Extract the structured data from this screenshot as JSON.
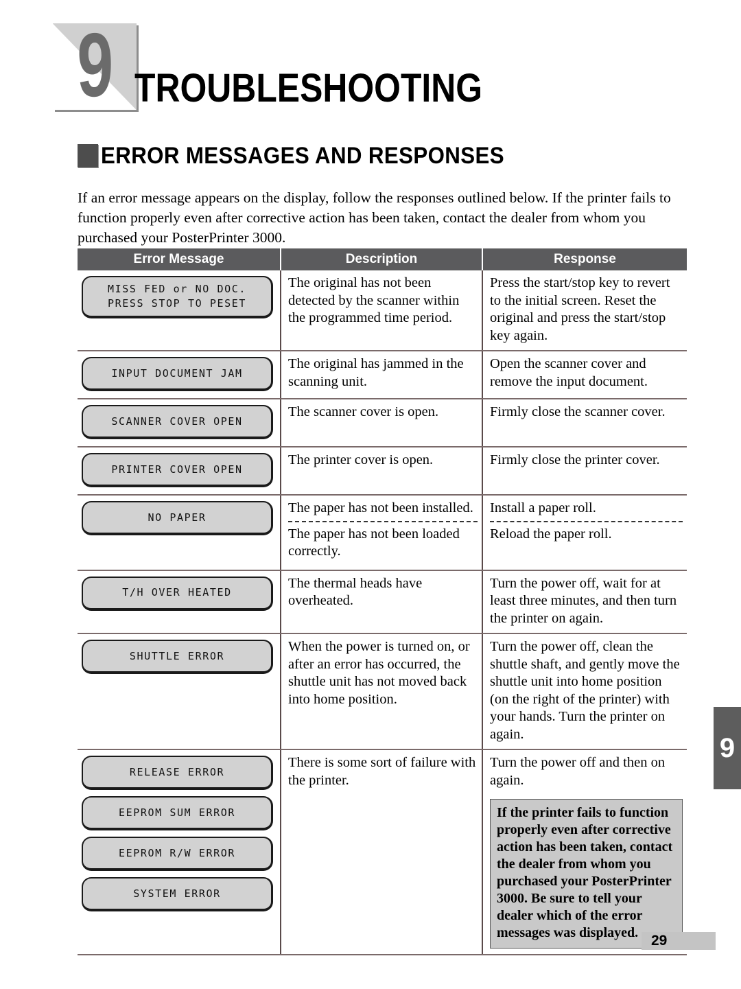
{
  "chapter": {
    "number": "9",
    "title": "TROUBLESHOOTING",
    "tab_number": "9"
  },
  "section": {
    "heading": "ERROR MESSAGES AND RESPONSES",
    "intro": "If an error message appears on the display, follow the responses outlined below.  If the printer fails to function properly even after corrective action has been taken, contact the dealer from whom you purchased your PosterPrinter 3000."
  },
  "table": {
    "headers": {
      "col1": "Error Message",
      "col2": "Description",
      "col3": "Response"
    },
    "rows": [
      {
        "messages": [
          {
            "lines": [
              "MISS FED or NO DOC.",
              "PRESS STOP TO PESET"
            ]
          }
        ],
        "description": "The original has not been detected by the scanner within the programmed time period.",
        "response": "Press the start/stop key to revert to the initial screen.  Reset the original and press the start/stop key again."
      },
      {
        "messages": [
          {
            "lines": [
              "INPUT DOCUMENT JAM"
            ]
          }
        ],
        "description": "The original has jammed in the scanning unit.",
        "response": "Open the scanner cover and remove the input document."
      },
      {
        "messages": [
          {
            "lines": [
              "SCANNER COVER OPEN"
            ]
          }
        ],
        "description": "The scanner cover is open.",
        "response": "Firmly close the scanner cover."
      },
      {
        "messages": [
          {
            "lines": [
              "PRINTER COVER OPEN"
            ]
          }
        ],
        "description": "The printer cover is open.",
        "response": "Firmly close the printer cover."
      },
      {
        "messages": [
          {
            "lines": [
              "NO PAPER"
            ]
          }
        ],
        "description_parts": [
          "The paper has not been installed.",
          "The paper has not been loaded correctly."
        ],
        "response_parts": [
          "Install a paper roll.",
          "Reload the paper roll."
        ]
      },
      {
        "messages": [
          {
            "lines": [
              "T/H OVER HEATED"
            ]
          }
        ],
        "description": "The thermal heads have overheated.",
        "response": "Turn the power off, wait for at least three minutes, and then turn the printer on again."
      },
      {
        "messages": [
          {
            "lines": [
              "SHUTTLE ERROR"
            ]
          }
        ],
        "description": "When the power is turned on, or after an error has occurred,  the shuttle unit has not moved back into home position.",
        "response": "Turn the power off, clean the shuttle shaft, and gently move the shuttle unit into home position (on the right of the printer) with your hands. Turn the printer on again."
      },
      {
        "messages": [
          {
            "lines": [
              "RELEASE ERROR"
            ]
          },
          {
            "lines": [
              "EEPROM SUM ERROR"
            ]
          },
          {
            "lines": [
              "EEPROM R/W ERROR"
            ]
          },
          {
            "lines": [
              "SYSTEM ERROR"
            ]
          }
        ],
        "description": "There is some sort of failure with the printer.",
        "response": "Turn the power off and then on again.",
        "callout": "If the printer fails to function properly even after corrective action has been taken, contact the dealer from whom you purchased your PosterPrinter 3000. Be sure to tell your dealer which of the error messages was displayed."
      }
    ]
  },
  "footer": {
    "page_number": "29"
  },
  "colors": {
    "header_bar": "#5b5b5d",
    "lcd_fill": "#d2d2d2",
    "callout_fill": "#c9c9c9",
    "tab_fill": "#5d5d5d",
    "badge_fill": "#d0d0d0"
  }
}
